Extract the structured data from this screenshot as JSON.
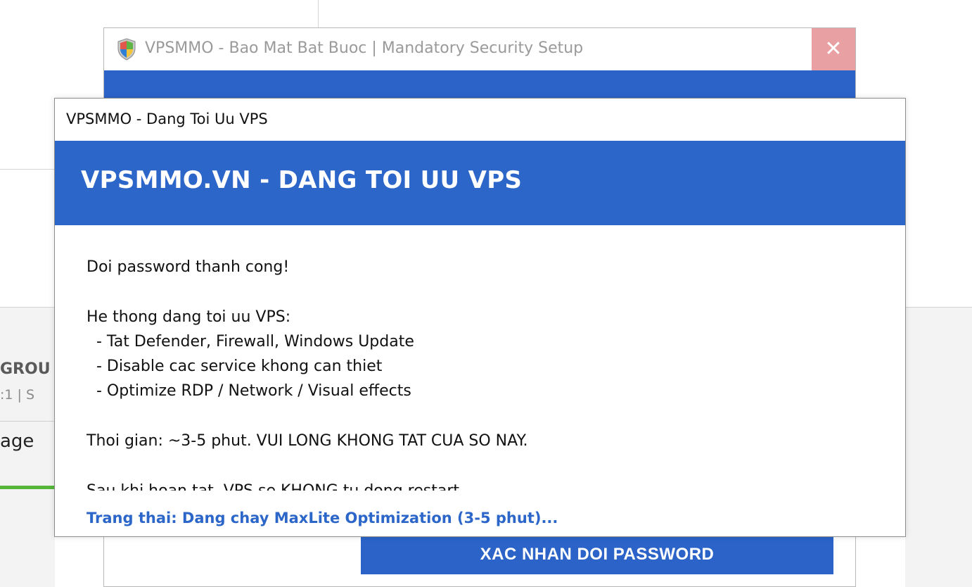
{
  "background": {
    "group_label": "GROU",
    "meta_text": ":1  |  S",
    "page_label": "age"
  },
  "security_window": {
    "title": "VPSMMO - Bao Mat Bat Buoc | Mandatory Security Setup",
    "close_icon": "close-icon",
    "shield_icon": "windows-shield-icon",
    "confirm_button": "XAC NHAN DOI PASSWORD"
  },
  "optimize_window": {
    "title": "VPSMMO - Dang Toi Uu VPS",
    "header": "VPSMMO.VN - DANG TOI UU VPS",
    "body": {
      "line1": "Doi password thanh cong!",
      "line2": "He thong dang toi uu VPS:",
      "line3": "  - Tat Defender, Firewall, Windows Update",
      "line4": "  - Disable cac service khong can thiet",
      "line5": "  - Optimize RDP / Network / Visual effects",
      "line6": "Thoi gian: ~3-5 phut. VUI LONG KHONG TAT CUA SO NAY.",
      "line7": "Sau khi hoan tat, VPS se KHONG tu dong restart."
    },
    "status": "Trang thai: Dang chay MaxLite Optimization (3-5 phut)..."
  },
  "colors": {
    "accent_blue": "#2c66c9",
    "close_red": "#e8a0a3",
    "progress_green": "#55b63a"
  }
}
